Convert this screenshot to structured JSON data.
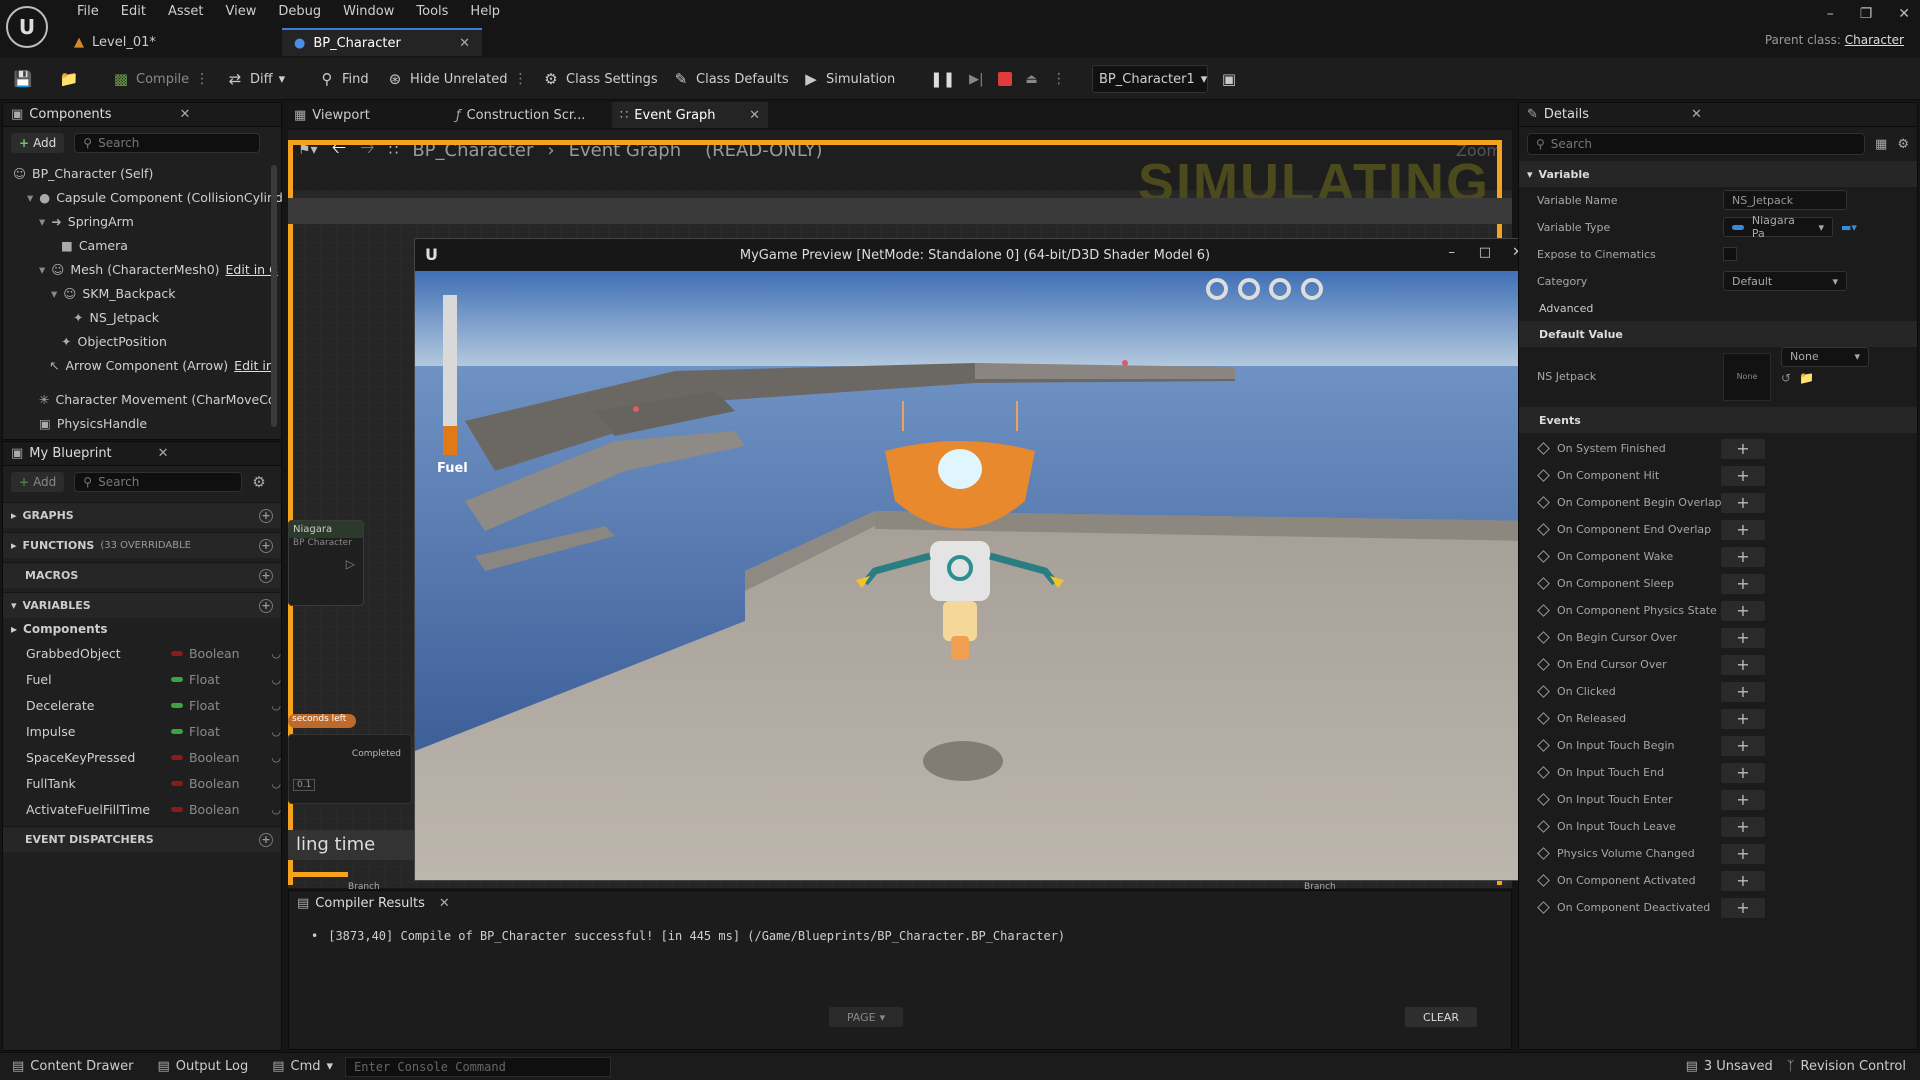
{
  "menu": [
    "File",
    "Edit",
    "Asset",
    "View",
    "Debug",
    "Window",
    "Tools",
    "Help"
  ],
  "doc_tabs": [
    {
      "label": "Level_01*"
    },
    {
      "label": "BP_Character"
    }
  ],
  "parent_class": {
    "label": "Parent class:",
    "value": "Character"
  },
  "toolbar": {
    "compile": "Compile",
    "diff": "Diff",
    "find": "Find",
    "hide_unrelated": "Hide Unrelated",
    "class_settings": "Class Settings",
    "class_defaults": "Class Defaults",
    "simulation": "Simulation",
    "debug_object": "BP_Character1"
  },
  "components_panel": {
    "title": "Components",
    "add": "Add",
    "search_placeholder": "Search",
    "tree": [
      {
        "label": "BP_Character (Self)"
      },
      {
        "label": "Capsule Component (CollisionCylind"
      },
      {
        "label": "SpringArm"
      },
      {
        "label": "Camera"
      },
      {
        "label": "Mesh (CharacterMesh0)",
        "link": "Edit in C"
      },
      {
        "label": "SKM_Backpack"
      },
      {
        "label": "NS_Jetpack"
      },
      {
        "label": "ObjectPosition"
      },
      {
        "label": "Arrow Component (Arrow)",
        "link": "Edit in"
      },
      {
        "label": "Character Movement (CharMoveCo"
      },
      {
        "label": "PhysicsHandle"
      }
    ]
  },
  "my_blueprint": {
    "title": "My Blueprint",
    "add": "Add",
    "search_placeholder": "Search",
    "sections": {
      "graphs": "GRAPHS",
      "functions": "FUNCTIONS",
      "functions_note": "(33 OVERRIDABLE",
      "macros": "MACROS",
      "variables": "VARIABLES",
      "event_dispatchers": "EVENT DISPATCHERS"
    },
    "var_group": "Components",
    "variables": [
      {
        "name": "GrabbedObject",
        "type": "Boolean",
        "color": "#8b1a1a"
      },
      {
        "name": "Fuel",
        "type": "Float",
        "color": "#3ea33e"
      },
      {
        "name": "Decelerate",
        "type": "Float",
        "color": "#3ea33e"
      },
      {
        "name": "Impulse",
        "type": "Float",
        "color": "#3ea33e"
      },
      {
        "name": "SpaceKeyPressed",
        "type": "Boolean",
        "color": "#8b1a1a"
      },
      {
        "name": "FullTank",
        "type": "Boolean",
        "color": "#8b1a1a"
      },
      {
        "name": "ActivateFuelFillTime",
        "type": "Boolean",
        "color": "#8b1a1a"
      }
    ]
  },
  "graph_tabs": {
    "viewport": "Viewport",
    "construction": "Construction Scr...",
    "event_graph": "Event Graph"
  },
  "breadcrumb": {
    "root": "BP_Character",
    "child": "Event Graph",
    "mode": "(READ-ONLY)"
  },
  "graph": {
    "simulating": "SIMULATING",
    "zoom": "Zoom",
    "node_title": "Niagara",
    "node_sub": "BP Character",
    "node_seconds": "seconds left",
    "node_completed": "Completed",
    "node_value": "0.1",
    "comment": "ling time",
    "branch_left": "Branch",
    "branch_right": "Branch"
  },
  "preview": {
    "title": "MyGame Preview [NetMode: Standalone 0]  (64-bit/D3D Shader Model 6)",
    "fuel_label": "Fuel",
    "fuel_level": 0.18
  },
  "compiler": {
    "title": "Compiler Results",
    "message": "[3873,40] Compile of BP_Character successful! [in 445 ms] (/Game/Blueprints/BP_Character.BP_Character)",
    "page": "PAGE",
    "clear": "CLEAR"
  },
  "details": {
    "title": "Details",
    "search_placeholder": "Search",
    "variable_section": "Variable",
    "variable_name_label": "Variable Name",
    "variable_name": "NS_Jetpack",
    "variable_type_label": "Variable Type",
    "variable_type": "Niagara Pa",
    "expose_label": "Expose to Cinematics",
    "category_label": "Category",
    "category": "Default",
    "advanced": "Advanced",
    "default_value_section": "Default Value",
    "ns_label": "NS Jetpack",
    "ns_thumb": "None",
    "ns_value": "None",
    "events_section": "Events",
    "events": [
      "On System Finished",
      "On Component Hit",
      "On Component Begin Overlap",
      "On Component End Overlap",
      "On Component Wake",
      "On Component Sleep",
      "On Component Physics State Cl",
      "On Begin Cursor Over",
      "On End Cursor Over",
      "On Clicked",
      "On Released",
      "On Input Touch Begin",
      "On Input Touch End",
      "On Input Touch Enter",
      "On Input Touch Leave",
      "Physics Volume Changed",
      "On Component Activated",
      "On Component Deactivated"
    ]
  },
  "statusbar": {
    "content_drawer": "Content Drawer",
    "output_log": "Output Log",
    "cmd": "Cmd",
    "console_placeholder": "Enter Console Command",
    "unsaved": "3 Unsaved",
    "revision": "Revision Control"
  }
}
